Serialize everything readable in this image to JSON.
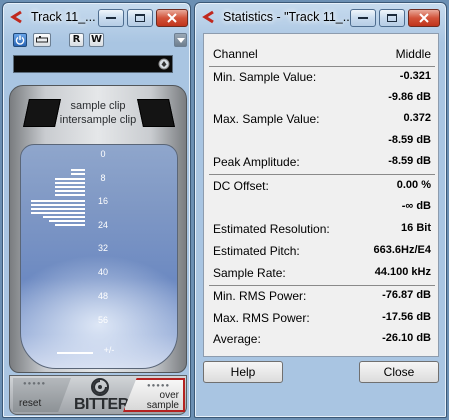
{
  "plugin_window": {
    "title": "Track 11_...",
    "toolbar": {
      "button_1": "R",
      "button_2": "W"
    },
    "clip_labels": {
      "sample": "sample clip",
      "intersample": "intersample clip"
    },
    "scale": [
      "0",
      "8",
      "16",
      "24",
      "32",
      "40",
      "48",
      "56",
      "+/-"
    ],
    "buttons": {
      "reset": "reset",
      "over_line1": "over",
      "over_line2": "sample"
    },
    "brand": "BITTER"
  },
  "stats_window": {
    "title": "Statistics - \"Track 11_...",
    "header": {
      "label": "Channel",
      "value": "Middle"
    },
    "rows": [
      {
        "label": "Min. Sample Value:",
        "value": "-0.321"
      },
      {
        "label": "",
        "value": "-9.86 dB"
      },
      {
        "label": "Max. Sample Value:",
        "value": "0.372"
      },
      {
        "label": "",
        "value": "-8.59 dB"
      },
      {
        "label": "Peak Amplitude:",
        "value": "-8.59 dB"
      },
      {
        "label": "DC Offset:",
        "value": "0.00 %"
      },
      {
        "label": "",
        "value": "-∞ dB"
      },
      {
        "label": "Estimated Resolution:",
        "value": "16 Bit"
      },
      {
        "label": "Estimated Pitch:",
        "value": "663.6Hz/E4"
      },
      {
        "label": "Sample Rate:",
        "value": "44.100 kHz"
      },
      {
        "label": "Min. RMS Power:",
        "value": "-76.87 dB"
      },
      {
        "label": "Max. RMS Power:",
        "value": "-17.56 dB"
      },
      {
        "label": "Average:",
        "value": "-26.10 dB"
      }
    ],
    "help_button": "Help",
    "close_button": "Close"
  }
}
